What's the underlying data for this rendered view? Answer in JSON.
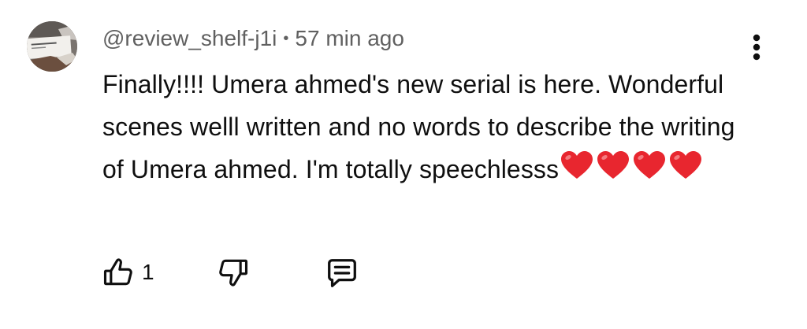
{
  "comment": {
    "author": "@review_shelf-j1i",
    "separator": "•",
    "timestamp": "57 min ago",
    "text": "Finally!!!! Umera ahmed's new serial is here. Wonderful scenes welll written and no words to describe the writing of Umera ahmed. I'm totally speechlesss",
    "heart_count": 4,
    "heart_color": "#e8262f",
    "avatar_icon": "avatar-book-photo"
  },
  "actions": {
    "like_count": "1",
    "like_icon": "thumbs-up-icon",
    "dislike_icon": "thumbs-down-icon",
    "reply_icon": "comment-reply-icon",
    "more_icon": "more-vertical-icon"
  },
  "colors": {
    "text_primary": "#0f0f0f",
    "text_secondary": "#606060",
    "background": "#ffffff"
  }
}
